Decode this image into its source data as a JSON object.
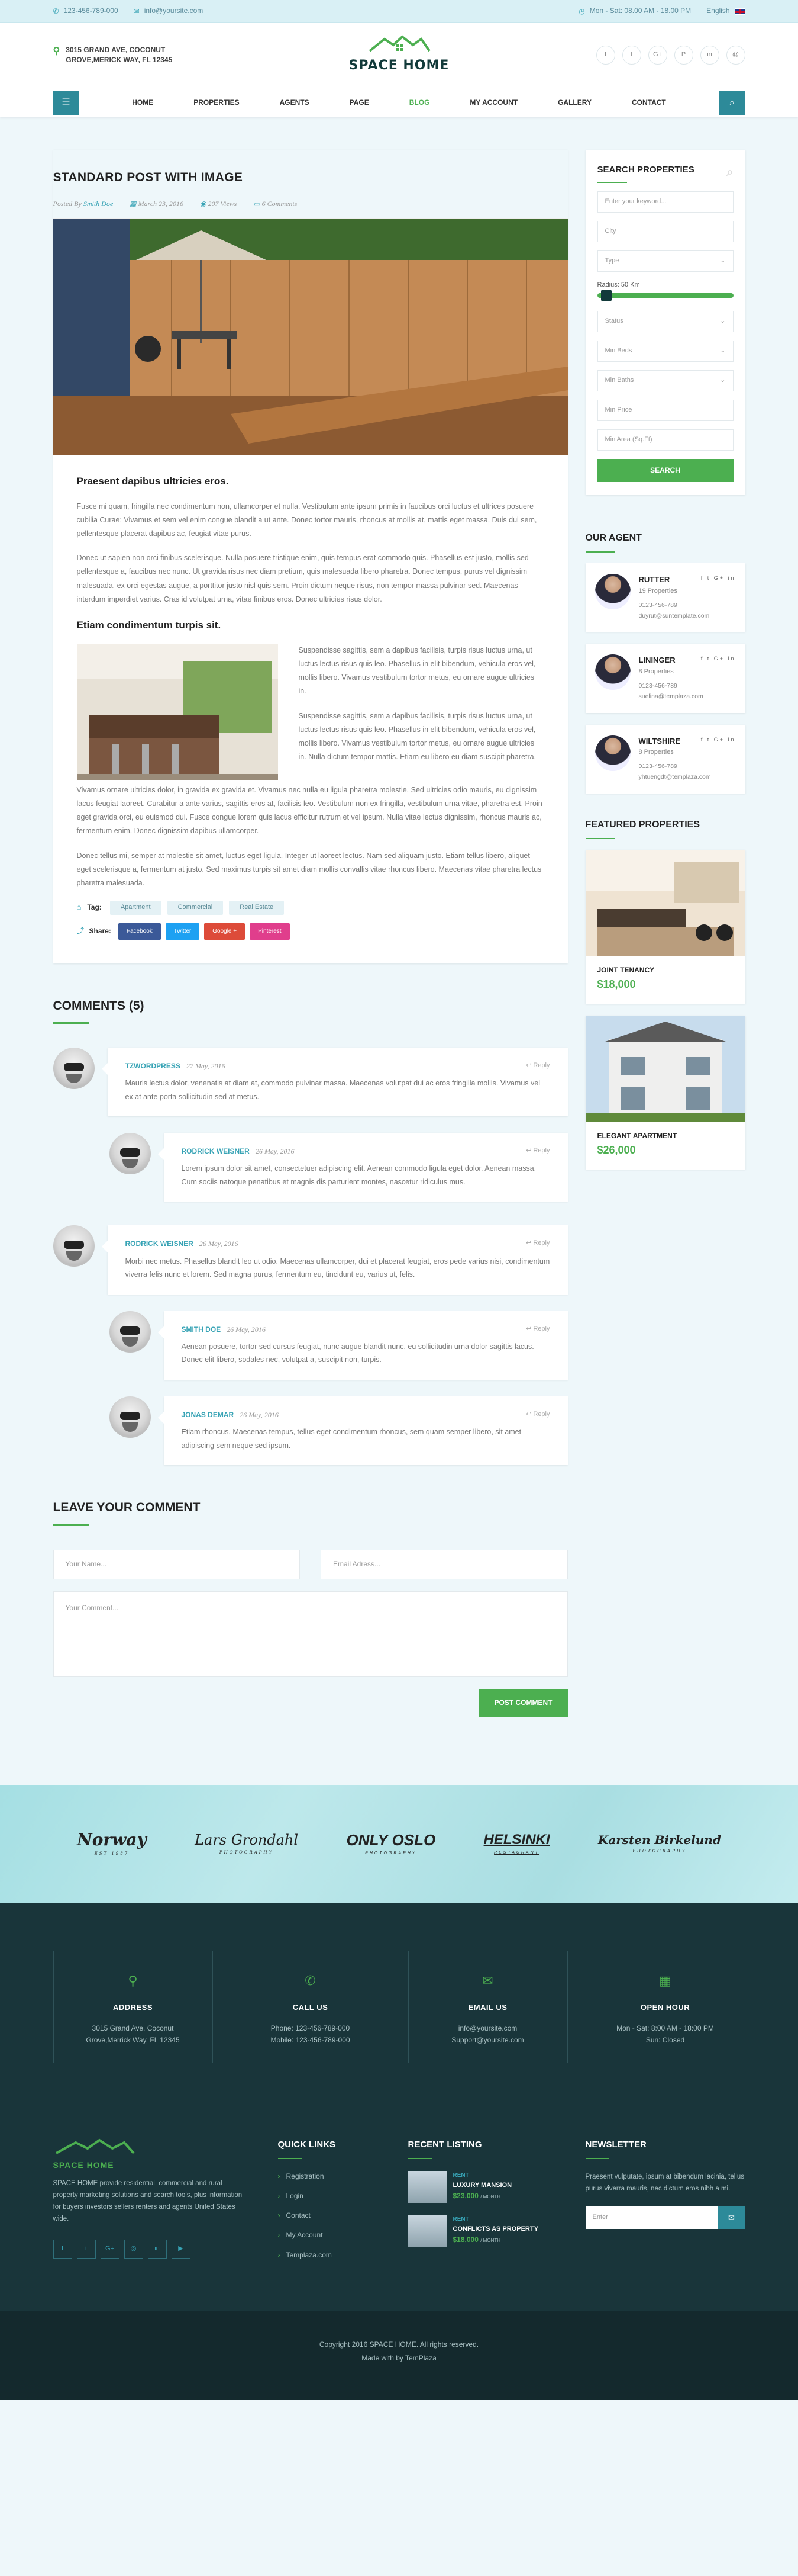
{
  "topbar": {
    "phone": "123-456-789-000",
    "email": "info@yoursite.com",
    "hours": "Mon - Sat: 08.00 AM - 18.00 PM",
    "language": "English"
  },
  "header": {
    "address_line1": "3015 GRAND AVE, COCONUT",
    "address_line2": "GROVE,MERICK WAY, FL 12345",
    "logo_text": "SPACE HOME",
    "social": [
      "f",
      "t",
      "G+",
      "P",
      "in",
      "@"
    ]
  },
  "nav": {
    "items": [
      "HOME",
      "PROPERTIES",
      "AGENTS",
      "PAGE",
      "BLOG",
      "MY ACCOUNT",
      "GALLERY",
      "CONTACT"
    ],
    "active": "BLOG"
  },
  "post": {
    "title": "STANDARD POST WITH IMAGE",
    "meta": {
      "posted_by": "Posted By",
      "author": "Smith Doe",
      "date": "March 23, 2016",
      "views": "207 Views",
      "comments": "6 Comments"
    },
    "h1": "Praesent dapibus ultricies eros.",
    "p1": "Fusce mi quam, fringilla nec condimentum non, ullamcorper et nulla. Vestibulum ante ipsum primis in faucibus orci luctus et ultrices posuere cubilia Curae; Vivamus et sem vel enim congue blandit a ut ante. Donec tortor mauris, rhoncus at mollis at, mattis eget massa. Duis dui sem, pellentesque placerat dapibus ac, feugiat vitae purus.",
    "p2": "Donec ut sapien non orci finibus scelerisque. Nulla posuere tristique enim, quis tempus erat commodo quis. Phasellus est justo, mollis sed pellentesque a, faucibus nec nunc. Ut gravida risus nec diam pretium, quis malesuada libero pharetra. Donec tempus, purus vel dignissim malesuada, ex orci egestas augue, a porttitor justo nisl quis sem. Proin dictum neque risus, non tempor massa pulvinar sed. Maecenas interdum imperdiet varius. Cras id volutpat urna, vitae finibus eros. Donec ultricies risus dolor.",
    "h2": "Etiam condimentum turpis sit.",
    "p3": "Suspendisse sagittis, sem a dapibus facilisis, turpis risus luctus urna, ut luctus lectus risus quis leo. Phasellus in elit bibendum, vehicula eros vel, mollis libero. Vivamus vestibulum tortor metus, eu ornare augue ultricies in.",
    "p4": "Suspendisse sagittis, sem a dapibus facilisis, turpis risus luctus urna, ut luctus lectus risus quis leo. Phasellus in elit bibendum, vehicula eros vel, mollis libero. Vivamus vestibulum tortor metus, eu ornare augue ultricies in. Nulla dictum tempor mattis. Etiam eu libero eu diam suscipit pharetra.",
    "p5": "Vivamus ornare ultricies dolor, in gravida ex gravida et. Vivamus nec nulla eu ligula pharetra molestie. Sed ultricies odio mauris, eu dignissim lacus feugiat laoreet. Curabitur a ante varius, sagittis eros at, facilisis leo. Vestibulum non ex fringilla, vestibulum urna vitae, pharetra est. Proin eget gravida orci, eu euismod dui. Fusce congue lorem quis lacus efficitur rutrum et vel ipsum. Nulla vitae lectus dignissim, rhoncus mauris ac, fermentum enim. Donec dignissim dapibus ullamcorper.",
    "p6": "Donec tellus mi, semper at molestie sit amet, luctus eget ligula. Integer ut laoreet lectus. Nam sed aliquam justo. Etiam tellus libero, aliquet eget scelerisque a, fermentum at justo. Sed maximus turpis sit amet diam mollis convallis vitae rhoncus libero. Maecenas vitae pharetra lectus pharetra malesuada.",
    "tag_label": "Tag:",
    "tags": [
      "Apartment",
      "Commercial",
      "Real Estate"
    ],
    "share_label": "Share:",
    "shares": [
      "Facebook",
      "Twitter",
      "Google +",
      "Pinterest"
    ]
  },
  "comments": {
    "title": "COMMENTS (5)",
    "reply": "Reply",
    "items": [
      {
        "name": "TZWORDPRESS",
        "date": "27 May, 2016",
        "text": "Mauris lectus dolor, venenatis at diam at, commodo pulvinar massa. Maecenas volutpat dui ac eros fringilla mollis. Vivamus vel ex at ante porta sollicitudin sed at metus."
      },
      {
        "name": "RODRICK WEISNER",
        "date": "26 May, 2016",
        "text": "Lorem ipsum dolor sit amet, consectetuer adipiscing elit. Aenean commodo ligula eget dolor. Aenean massa. Cum sociis natoque penatibus et magnis dis parturient montes, nascetur ridiculus mus."
      },
      {
        "name": "RODRICK WEISNER",
        "date": "26 May, 2016",
        "text": "Morbi nec metus. Phasellus blandit leo ut odio. Maecenas ullamcorper, dui et placerat feugiat, eros pede varius nisi, condimentum viverra felis nunc et lorem. Sed magna purus, fermentum eu, tincidunt eu, varius ut, felis."
      },
      {
        "name": "SMITH DOE",
        "date": "26 May, 2016",
        "text": "Aenean posuere, tortor sed cursus feugiat, nunc augue blandit nunc, eu sollicitudin urna dolor sagittis lacus. Donec elit libero, sodales nec, volutpat a, suscipit non, turpis."
      },
      {
        "name": "JONAS DEMAR",
        "date": "26 May, 2016",
        "text": "Etiam rhoncus. Maecenas tempus, tellus eget condimentum rhoncus, sem quam semper libero, sit amet adipiscing sem neque sed ipsum."
      }
    ]
  },
  "leave": {
    "title": "LEAVE YOUR COMMENT",
    "name_ph": "Your Name...",
    "email_ph": "Email Adress...",
    "comment_ph": "Your Comment...",
    "submit": "POST COMMENT"
  },
  "search": {
    "title": "SEARCH PROPERTIES",
    "keyword": "Enter your keyword...",
    "city": "City",
    "type": "Type",
    "radius": "Radius: 50 Km",
    "status": "Status",
    "beds": "Min Beds",
    "baths": "Min Baths",
    "price": "Min Price",
    "area": "Min Area (Sq.Ft)",
    "button": "SEARCH"
  },
  "agents": {
    "title": "OUR AGENT",
    "items": [
      {
        "name": "RUTTER",
        "props": "19 Properties",
        "phone": "0123-456-789",
        "email": "duyrut@suntemplate.com"
      },
      {
        "name": "LININGER",
        "props": "8 Properties",
        "phone": "0123-456-789",
        "email": "suelina@templaza.com"
      },
      {
        "name": "WILTSHIRE",
        "props": "8 Properties",
        "phone": "0123-456-789",
        "email": "yhtuengdt@templaza.com"
      }
    ]
  },
  "featured": {
    "title": "FEATURED PROPERTIES",
    "items": [
      {
        "name": "JOINT TENANCY",
        "price": "$18,000"
      },
      {
        "name": "ELEGANT APARTMENT",
        "price": "$26,000"
      }
    ]
  },
  "partners": [
    {
      "name": "Norway",
      "sub": "EST 1987"
    },
    {
      "name": "Lars Grondahl",
      "sub": "PHOTOGRAPHY"
    },
    {
      "name": "ONLY OSLO",
      "sub": "PHOTOGRAPHY"
    },
    {
      "name": "HELSINKI",
      "sub": "RESTAURANT"
    },
    {
      "name": "Karsten Birkelund",
      "sub": "PHOTOGRAPHY"
    }
  ],
  "footer": {
    "boxes": [
      {
        "title": "ADDRESS",
        "l1": "3015 Grand Ave, Coconut",
        "l2": "Grove,Merrick Way, FL 12345"
      },
      {
        "title": "CALL US",
        "l1": "Phone: 123-456-789-000",
        "l2": "Mobile: 123-456-789-000"
      },
      {
        "title": "EMAIL US",
        "l1": "info@yoursite.com",
        "l2": "Support@yoursite.com"
      },
      {
        "title": "OPEN HOUR",
        "l1": "Mon - Sat: 8:00 AM - 18:00 PM",
        "l2": "Sun: Closed"
      }
    ],
    "logo_text": "SPACE HOME",
    "about": "SPACE HOME provide residential, commercial and rural property marketing solutions and search tools, plus information for buyers investors sellers renters and agents United States wide.",
    "quick_title": "QUICK LINKS",
    "quick": [
      "Registration",
      "Login",
      "Contact",
      "My Account",
      "Templaza.com"
    ],
    "recent_title": "RECENT LISTING",
    "recent": [
      {
        "tag": "RENT",
        "name": "LUXURY MANSION",
        "price": "$23,000",
        "unit": "/ MONTH"
      },
      {
        "tag": "RENT",
        "name": "CONFLICTS AS PROPERTY",
        "price": "$18,000",
        "unit": "/ MONTH"
      }
    ],
    "news_title": "NEWSLETTER",
    "news_text": "Praesent vulputate, ipsum at bibendum lacinia, tellus purus viverra mauris, nec dictum eros nibh a mi.",
    "news_ph": "Enter",
    "copy1": "Copyright 2016 SPACE HOME. All rights reserved.",
    "copy2": "Made with by TemPlaza"
  }
}
